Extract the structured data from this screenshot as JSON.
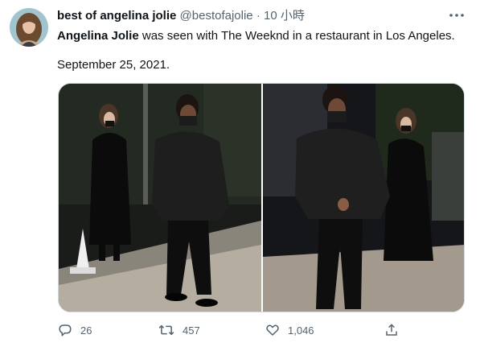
{
  "account": {
    "display_name": "best of angelina jolie",
    "handle": "@bestofajolie",
    "separator": "·",
    "time": "10 小時"
  },
  "tweet": {
    "bold_name": "Angelina Jolie",
    "text_rest": " was seen with The Weeknd in a restaurant in Los Angeles.",
    "date_line": "September 25, 2021."
  },
  "media": {
    "photos": [
      {
        "subject": "photo-woman-and-man-walking-at-night"
      },
      {
        "subject": "photo-man-in-mask-walking-at-night"
      }
    ]
  },
  "actions": {
    "reply_count": "26",
    "retweet_count": "457",
    "like_count": "1,046"
  },
  "icons": {
    "more": "more-icon",
    "reply": "reply-icon",
    "retweet": "retweet-icon",
    "like": "heart-icon",
    "share": "share-icon"
  },
  "colors": {
    "text": "#0f1419",
    "secondary": "#536471",
    "border": "#cfd9de"
  }
}
